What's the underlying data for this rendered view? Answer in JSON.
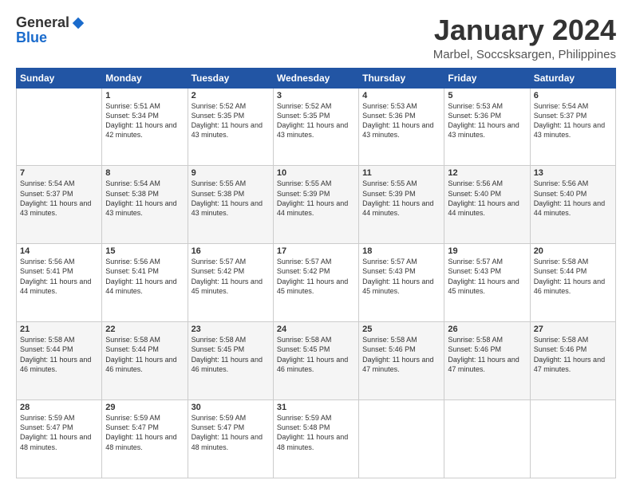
{
  "app": {
    "logo_general": "General",
    "logo_blue": "Blue",
    "month_title": "January 2024",
    "location": "Marbel, Soccsksargen, Philippines"
  },
  "days": [
    "Sunday",
    "Monday",
    "Tuesday",
    "Wednesday",
    "Thursday",
    "Friday",
    "Saturday"
  ],
  "weeks": [
    [
      {
        "day": "",
        "sunrise": "",
        "sunset": "",
        "daylight": ""
      },
      {
        "day": "1",
        "sunrise": "Sunrise: 5:51 AM",
        "sunset": "Sunset: 5:34 PM",
        "daylight": "Daylight: 11 hours and 42 minutes."
      },
      {
        "day": "2",
        "sunrise": "Sunrise: 5:52 AM",
        "sunset": "Sunset: 5:35 PM",
        "daylight": "Daylight: 11 hours and 43 minutes."
      },
      {
        "day": "3",
        "sunrise": "Sunrise: 5:52 AM",
        "sunset": "Sunset: 5:35 PM",
        "daylight": "Daylight: 11 hours and 43 minutes."
      },
      {
        "day": "4",
        "sunrise": "Sunrise: 5:53 AM",
        "sunset": "Sunset: 5:36 PM",
        "daylight": "Daylight: 11 hours and 43 minutes."
      },
      {
        "day": "5",
        "sunrise": "Sunrise: 5:53 AM",
        "sunset": "Sunset: 5:36 PM",
        "daylight": "Daylight: 11 hours and 43 minutes."
      },
      {
        "day": "6",
        "sunrise": "Sunrise: 5:54 AM",
        "sunset": "Sunset: 5:37 PM",
        "daylight": "Daylight: 11 hours and 43 minutes."
      }
    ],
    [
      {
        "day": "7",
        "sunrise": "Sunrise: 5:54 AM",
        "sunset": "Sunset: 5:37 PM",
        "daylight": "Daylight: 11 hours and 43 minutes."
      },
      {
        "day": "8",
        "sunrise": "Sunrise: 5:54 AM",
        "sunset": "Sunset: 5:38 PM",
        "daylight": "Daylight: 11 hours and 43 minutes."
      },
      {
        "day": "9",
        "sunrise": "Sunrise: 5:55 AM",
        "sunset": "Sunset: 5:38 PM",
        "daylight": "Daylight: 11 hours and 43 minutes."
      },
      {
        "day": "10",
        "sunrise": "Sunrise: 5:55 AM",
        "sunset": "Sunset: 5:39 PM",
        "daylight": "Daylight: 11 hours and 44 minutes."
      },
      {
        "day": "11",
        "sunrise": "Sunrise: 5:55 AM",
        "sunset": "Sunset: 5:39 PM",
        "daylight": "Daylight: 11 hours and 44 minutes."
      },
      {
        "day": "12",
        "sunrise": "Sunrise: 5:56 AM",
        "sunset": "Sunset: 5:40 PM",
        "daylight": "Daylight: 11 hours and 44 minutes."
      },
      {
        "day": "13",
        "sunrise": "Sunrise: 5:56 AM",
        "sunset": "Sunset: 5:40 PM",
        "daylight": "Daylight: 11 hours and 44 minutes."
      }
    ],
    [
      {
        "day": "14",
        "sunrise": "Sunrise: 5:56 AM",
        "sunset": "Sunset: 5:41 PM",
        "daylight": "Daylight: 11 hours and 44 minutes."
      },
      {
        "day": "15",
        "sunrise": "Sunrise: 5:56 AM",
        "sunset": "Sunset: 5:41 PM",
        "daylight": "Daylight: 11 hours and 44 minutes."
      },
      {
        "day": "16",
        "sunrise": "Sunrise: 5:57 AM",
        "sunset": "Sunset: 5:42 PM",
        "daylight": "Daylight: 11 hours and 45 minutes."
      },
      {
        "day": "17",
        "sunrise": "Sunrise: 5:57 AM",
        "sunset": "Sunset: 5:42 PM",
        "daylight": "Daylight: 11 hours and 45 minutes."
      },
      {
        "day": "18",
        "sunrise": "Sunrise: 5:57 AM",
        "sunset": "Sunset: 5:43 PM",
        "daylight": "Daylight: 11 hours and 45 minutes."
      },
      {
        "day": "19",
        "sunrise": "Sunrise: 5:57 AM",
        "sunset": "Sunset: 5:43 PM",
        "daylight": "Daylight: 11 hours and 45 minutes."
      },
      {
        "day": "20",
        "sunrise": "Sunrise: 5:58 AM",
        "sunset": "Sunset: 5:44 PM",
        "daylight": "Daylight: 11 hours and 46 minutes."
      }
    ],
    [
      {
        "day": "21",
        "sunrise": "Sunrise: 5:58 AM",
        "sunset": "Sunset: 5:44 PM",
        "daylight": "Daylight: 11 hours and 46 minutes."
      },
      {
        "day": "22",
        "sunrise": "Sunrise: 5:58 AM",
        "sunset": "Sunset: 5:44 PM",
        "daylight": "Daylight: 11 hours and 46 minutes."
      },
      {
        "day": "23",
        "sunrise": "Sunrise: 5:58 AM",
        "sunset": "Sunset: 5:45 PM",
        "daylight": "Daylight: 11 hours and 46 minutes."
      },
      {
        "day": "24",
        "sunrise": "Sunrise: 5:58 AM",
        "sunset": "Sunset: 5:45 PM",
        "daylight": "Daylight: 11 hours and 46 minutes."
      },
      {
        "day": "25",
        "sunrise": "Sunrise: 5:58 AM",
        "sunset": "Sunset: 5:46 PM",
        "daylight": "Daylight: 11 hours and 47 minutes."
      },
      {
        "day": "26",
        "sunrise": "Sunrise: 5:58 AM",
        "sunset": "Sunset: 5:46 PM",
        "daylight": "Daylight: 11 hours and 47 minutes."
      },
      {
        "day": "27",
        "sunrise": "Sunrise: 5:58 AM",
        "sunset": "Sunset: 5:46 PM",
        "daylight": "Daylight: 11 hours and 47 minutes."
      }
    ],
    [
      {
        "day": "28",
        "sunrise": "Sunrise: 5:59 AM",
        "sunset": "Sunset: 5:47 PM",
        "daylight": "Daylight: 11 hours and 48 minutes."
      },
      {
        "day": "29",
        "sunrise": "Sunrise: 5:59 AM",
        "sunset": "Sunset: 5:47 PM",
        "daylight": "Daylight: 11 hours and 48 minutes."
      },
      {
        "day": "30",
        "sunrise": "Sunrise: 5:59 AM",
        "sunset": "Sunset: 5:47 PM",
        "daylight": "Daylight: 11 hours and 48 minutes."
      },
      {
        "day": "31",
        "sunrise": "Sunrise: 5:59 AM",
        "sunset": "Sunset: 5:48 PM",
        "daylight": "Daylight: 11 hours and 48 minutes."
      },
      {
        "day": "",
        "sunrise": "",
        "sunset": "",
        "daylight": ""
      },
      {
        "day": "",
        "sunrise": "",
        "sunset": "",
        "daylight": ""
      },
      {
        "day": "",
        "sunrise": "",
        "sunset": "",
        "daylight": ""
      }
    ]
  ]
}
